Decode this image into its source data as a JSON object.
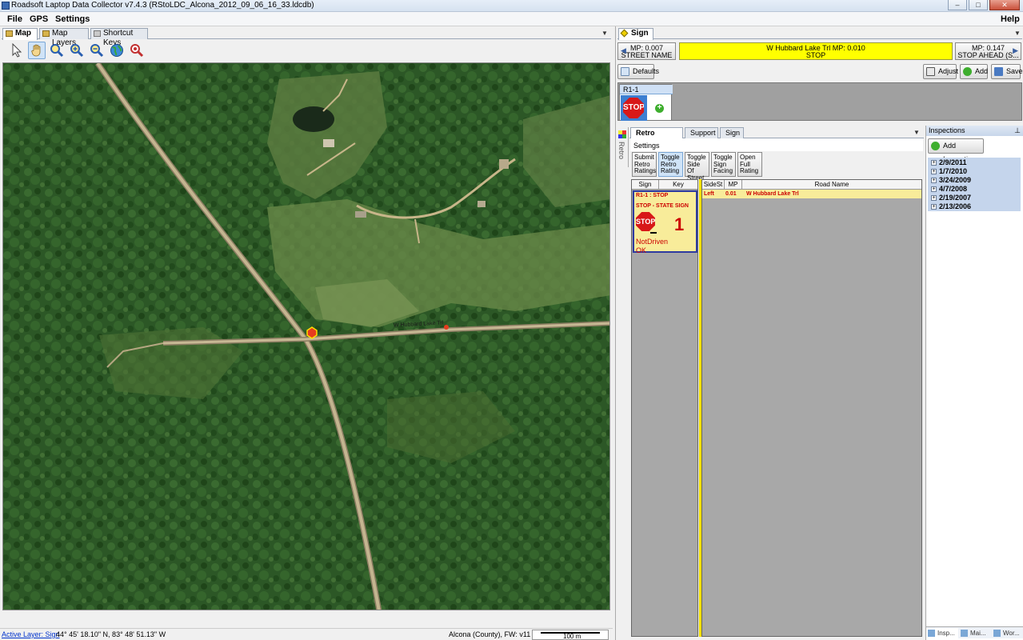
{
  "app": {
    "title": "Roadsoft Laptop Data Collector v7.4.3 (RStoLDC_Alcona_2012_09_06_16_33.ldcdb)",
    "window_buttons": {
      "minimize": "–",
      "maximize": "□",
      "close": "✕"
    }
  },
  "menu": {
    "file": "File",
    "gps": "GPS",
    "settings": "Settings",
    "help": "Help"
  },
  "left_tabs": {
    "map": "Map",
    "layers": "Map Layers",
    "keys": "Shortcut Keys"
  },
  "map": {
    "road_label": "W Hubbard Lake Trl"
  },
  "status": {
    "active_layer": "Active Layer: Sign",
    "coords": "44° 45' 18.10\" N, 83° 48' 51.13\" W",
    "county": "Alcona (County), FW: v11",
    "scale": "100 m"
  },
  "right": {
    "tab": "Sign",
    "prev": {
      "mp": "MP: 0.007",
      "name": "STREET NAME"
    },
    "current": {
      "line1": "W Hubbard Lake Trl MP: 0.010",
      "line2": "STOP"
    },
    "next": {
      "mp": "MP: 0.147",
      "name": "STOP AHEAD (S..."
    },
    "buttons": {
      "defaults": "Defaults",
      "adjust": "Adjust",
      "add": "Add",
      "save": "Save"
    },
    "sign_code": "R1-1",
    "stop_text": "STOP",
    "retro_side_label": "Retro",
    "subtabs": {
      "retro": "Retro Rating",
      "support": "Support",
      "sign": "Sign"
    },
    "settings": "Settings",
    "toggles": [
      "Submit Retro Ratings",
      "Toggle Retro Rating",
      "Toggle Side Of Street",
      "Toggle Sign Facing",
      "Open Full Rating"
    ],
    "list_headers": {
      "sign": "Sign",
      "key": "Key"
    },
    "card": {
      "line1": "R1-1 : STOP",
      "line2": "STOP - STATE SIGN",
      "key": "1",
      "status1": "NotDriven",
      "status2": "OK"
    },
    "grid_headers": {
      "side": "SideSt",
      "mp": "MP",
      "road": "Road Name"
    },
    "grid_row": {
      "side": "Left",
      "mp": "0.01",
      "road": "W Hubbard Lake Trl"
    }
  },
  "inspections": {
    "header": "Inspections",
    "add_button": "Add Inspection",
    "dates": [
      "2/9/2011",
      "1/7/2010",
      "3/24/2009",
      "4/7/2008",
      "2/19/2007",
      "2/13/2006"
    ],
    "bottom_tabs": [
      "Insp...",
      "Mai...",
      "Wor..."
    ]
  },
  "colors": {
    "highlight_yellow": "#ffff00",
    "stop_red": "#d81818",
    "card_bg": "#f8ec9a"
  }
}
